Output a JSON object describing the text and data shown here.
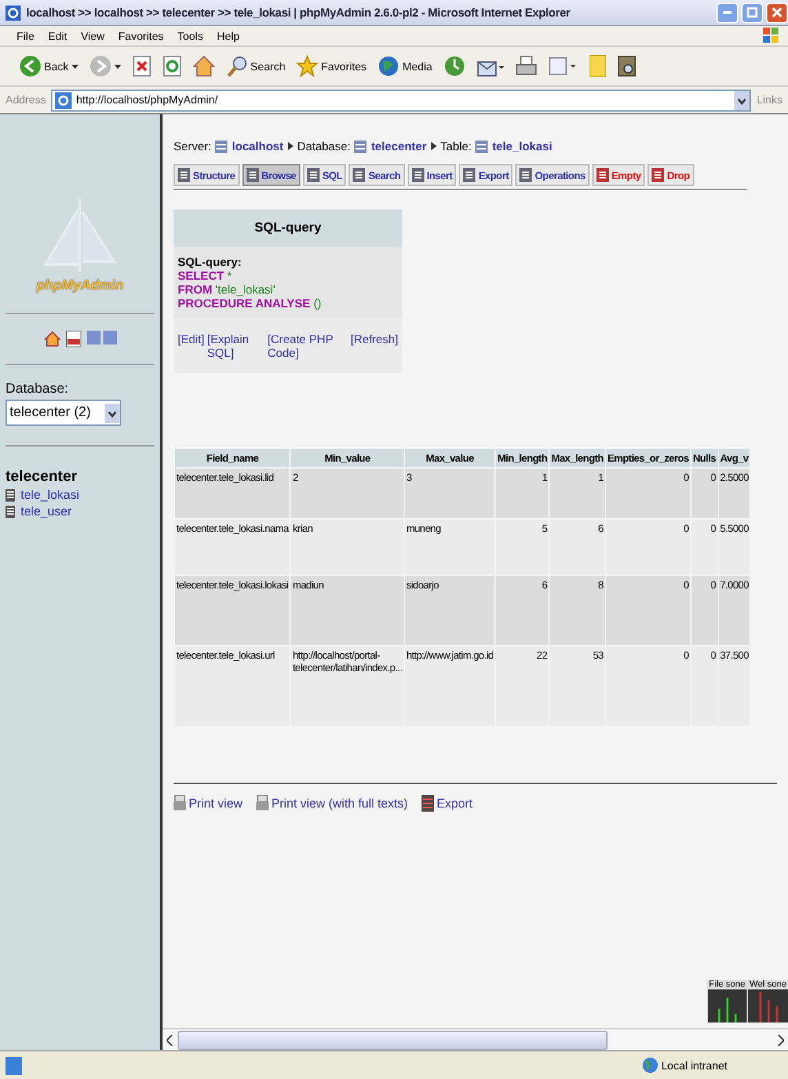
{
  "window": {
    "title": "localhost >> localhost >> telecenter >> tele_lokasi | phpMyAdmin 2.6.0-pl2 - Microsoft Internet Explorer"
  },
  "menu": [
    "File",
    "Edit",
    "View",
    "Favorites",
    "Tools",
    "Help"
  ],
  "toolbar": [
    {
      "kind": "back",
      "label": "Back"
    },
    {
      "kind": "forward"
    },
    {
      "kind": "stop"
    },
    {
      "kind": "refresh"
    },
    {
      "kind": "home"
    },
    {
      "kind": "search",
      "label": "Search"
    },
    {
      "kind": "favorites",
      "label": "Favorites"
    },
    {
      "kind": "media",
      "label": "Media"
    },
    {
      "kind": "history"
    },
    {
      "kind": "mail"
    },
    {
      "kind": "print"
    },
    {
      "kind": "edit"
    },
    {
      "kind": "notes"
    },
    {
      "kind": "research"
    }
  ],
  "address": {
    "label": "Address",
    "value": "http://localhost/phpMyAdmin/",
    "links": "Links"
  },
  "sidebar": {
    "logo": "phpMyAdmin",
    "database_label": "Database:",
    "database_value": "telecenter (2)",
    "db_name": "telecenter",
    "tables": [
      "tele_lokasi",
      "tele_user"
    ]
  },
  "breadcrumb": [
    {
      "label": "Server:",
      "value": "localhost"
    },
    {
      "label": "Database:",
      "value": "telecenter"
    },
    {
      "label": "Table:",
      "value": "tele_lokasi"
    }
  ],
  "tabs": [
    {
      "label": "Structure",
      "selected": false,
      "danger": false
    },
    {
      "label": "Browse",
      "selected": true,
      "danger": false
    },
    {
      "label": "SQL",
      "selected": false,
      "danger": false
    },
    {
      "label": "Search",
      "selected": false,
      "danger": false
    },
    {
      "label": "Insert",
      "selected": false,
      "danger": false
    },
    {
      "label": "Export",
      "selected": false,
      "danger": false
    },
    {
      "label": "Operations",
      "selected": false,
      "danger": false
    },
    {
      "label": "Empty",
      "selected": false,
      "danger": true
    },
    {
      "label": "Drop",
      "selected": false,
      "danger": true
    }
  ],
  "sql_box": {
    "title": "SQL-query",
    "label": "SQL-query:",
    "lines": [
      {
        "keyword": "SELECT",
        "rest": "*"
      },
      {
        "keyword": "FROM",
        "rest": "'tele_lokasi'"
      },
      {
        "keyword": "PROCEDURE ANALYSE",
        "rest": "()"
      }
    ],
    "links": [
      "[Edit]",
      "[Explain SQL]",
      "[Create PHP Code]",
      "[Refresh]"
    ]
  },
  "table": {
    "columns": [
      "Field_name",
      "Min_value",
      "Max_value",
      "Min_length",
      "Max_length",
      "Empties_or_zeros",
      "Nulls",
      "Avg_v"
    ],
    "rows": [
      [
        "telecenter.tele_lokasi.lid",
        "2",
        "3",
        "1",
        "1",
        "0",
        "0",
        "2.5000"
      ],
      [
        "telecenter.tele_lokasi.nama",
        "krian",
        "muneng",
        "5",
        "6",
        "0",
        "0",
        "5.5000"
      ],
      [
        "telecenter.tele_lokasi.lokasi",
        "madiun",
        "sidoarjo",
        "6",
        "8",
        "0",
        "0",
        "7.0000"
      ],
      [
        "telecenter.tele_lokasi.url",
        "http://localhost/portal-telecenter/latihan/index.p...",
        "http://www.jatim.go.id",
        "22",
        "53",
        "0",
        "0",
        "37.500"
      ]
    ]
  },
  "footer_links": [
    "Print view",
    "Print view (with full texts)",
    "Export"
  ],
  "meter": {
    "labels": [
      "File sone",
      "Wel sone"
    ]
  },
  "status_bar": {
    "zone": "Local intranet"
  }
}
